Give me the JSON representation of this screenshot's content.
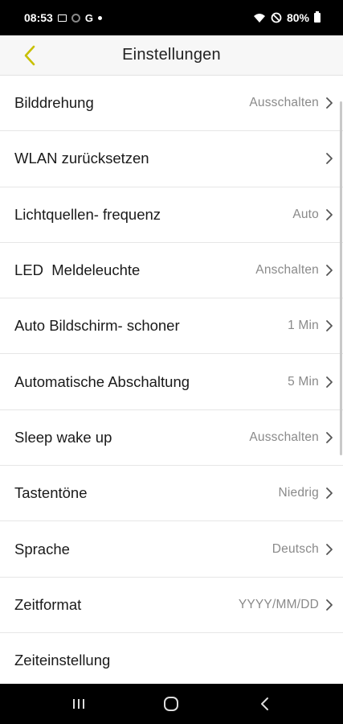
{
  "status_bar": {
    "time": "08:53",
    "g_letter": "G",
    "battery": "80%"
  },
  "header": {
    "title": "Einstellungen"
  },
  "settings": [
    {
      "label": "Bilddrehung",
      "value": "Ausschalten",
      "chevron": true
    },
    {
      "label": "WLAN zurücksetzen",
      "value": "",
      "chevron": true
    },
    {
      "label": "Lichtquellen- frequenz",
      "value": "Auto",
      "chevron": true
    },
    {
      "label": "LED  Meldeleuchte",
      "value": "Anschalten",
      "chevron": true
    },
    {
      "label": "Auto Bildschirm- schoner",
      "value": "1 Min",
      "chevron": true
    },
    {
      "label": "Automatische Abschaltung",
      "value": "5 Min",
      "chevron": true
    },
    {
      "label": "Sleep wake up",
      "value": "Ausschalten",
      "chevron": true
    },
    {
      "label": "Tastentöne",
      "value": "Niedrig",
      "chevron": true
    },
    {
      "label": "Sprache",
      "value": "Deutsch",
      "chevron": true
    },
    {
      "label": "Zeitformat",
      "value": "YYYY/MM/DD",
      "chevron": true
    },
    {
      "label": "Zeiteinstellung",
      "value": "",
      "chevron": false
    }
  ],
  "colors": {
    "accent": "#c8c000",
    "label": "#1a1a1a",
    "value": "#8a8a8a",
    "divider": "#e6e6e6"
  },
  "icons": {
    "back": "chevron-left-icon",
    "row_arrow": "chevron-right-icon",
    "nav_recents": "recents-icon",
    "nav_home": "home-icon",
    "nav_back": "back-icon"
  }
}
